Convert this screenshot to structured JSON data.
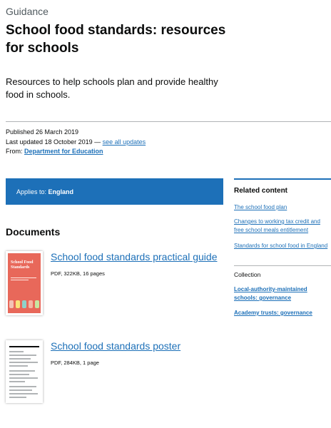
{
  "header": {
    "caption": "Guidance",
    "title": "School food standards: resources for schools",
    "lead": "Resources to help schools plan and provide healthy food in schools."
  },
  "metadata": {
    "published": "Published 26 March 2019",
    "last_updated": "Last updated 18 October 2019 —",
    "see_all_updates": "see all updates",
    "from_label": "From:",
    "from_org": "Department for Education"
  },
  "applies_to": {
    "label": "Applies to:",
    "value": "England"
  },
  "documents": {
    "heading": "Documents",
    "items": [
      {
        "title": "School food standards practical guide",
        "meta": "PDF, 322KB, 16 pages",
        "thumb_text": "School Food Standards"
      },
      {
        "title": "School food standards poster",
        "meta": "PDF, 284KB, 1 page"
      }
    ]
  },
  "sidebar": {
    "related_heading": "Related content",
    "related_links": [
      "The school food plan",
      "Changes to working tax credit and free school meals entitlement",
      "Standards for school food in England"
    ],
    "collection_heading": "Collection",
    "collection_links": [
      "Local-authority-maintained schools: governance",
      "Academy trusts: governance"
    ]
  },
  "colors": {
    "link": "#1d70b8",
    "text": "#0b0c0c",
    "secondary_text": "#505a5f",
    "applies_bg": "#1d70b8",
    "guide_cover": "#e8685a"
  }
}
